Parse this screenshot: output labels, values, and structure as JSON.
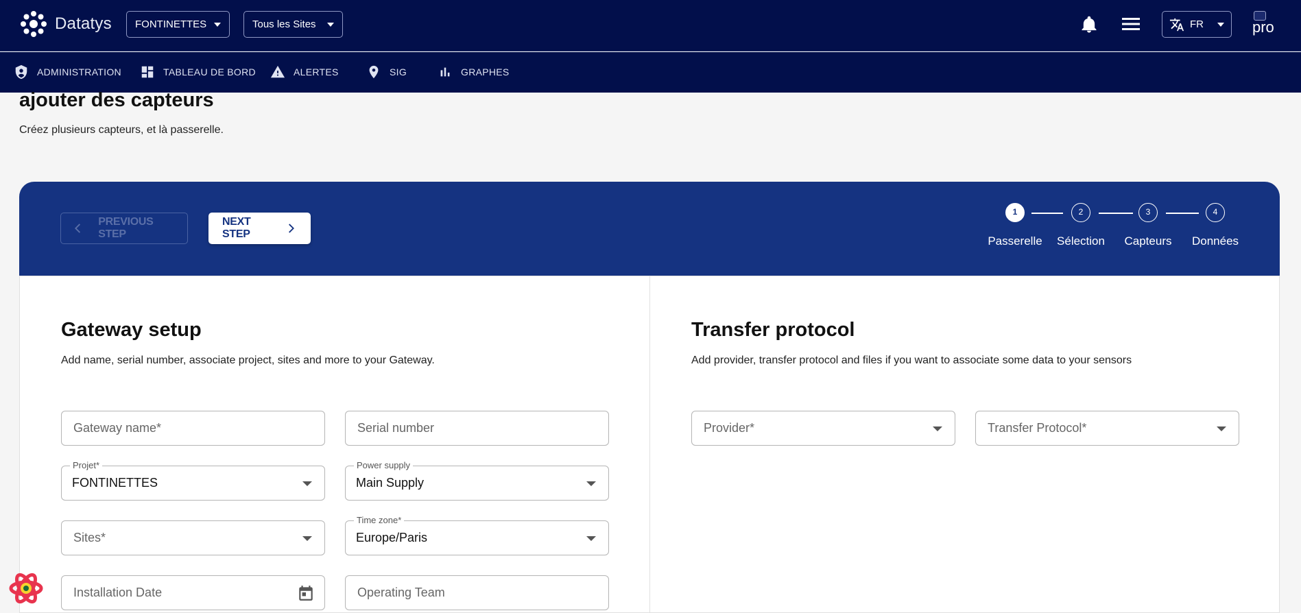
{
  "header": {
    "app_name": "Datatys",
    "project_select": "FONTINETTES",
    "sites_select": "Tous les Sites",
    "lang": "FR",
    "avatar_alt": "pro"
  },
  "nav": {
    "items": [
      {
        "label": "ADMINISTRATION",
        "icon": "shield-icon"
      },
      {
        "label": "TABLEAU DE BORD",
        "icon": "dashboard-icon"
      },
      {
        "label": "ALERTES",
        "icon": "warning-icon"
      },
      {
        "label": "SIG",
        "icon": "map-pin-icon"
      },
      {
        "label": "GRAPHES",
        "icon": "bar-chart-icon"
      }
    ]
  },
  "page": {
    "title": "ajouter des capteurs",
    "subtitle": "Créez plusieurs capteurs, et là passerelle."
  },
  "stepper": {
    "prev_label": "PREVIOUS STEP",
    "next_label": "NEXT STEP",
    "steps": [
      {
        "num": "1",
        "label": "Passerelle"
      },
      {
        "num": "2",
        "label": "Sélection"
      },
      {
        "num": "3",
        "label": "Capteurs"
      },
      {
        "num": "4",
        "label": "Données"
      }
    ],
    "active_step": 1
  },
  "gateway": {
    "title": "Gateway setup",
    "desc": "Add name, serial number, associate project, sites and more to your Gateway.",
    "name_ph": "Gateway name*",
    "serial_ph": "Serial number",
    "project_label": "Projet*",
    "project_value": "FONTINETTES",
    "power_label": "Power supply",
    "power_value": "Main Supply",
    "sites_ph": "Sites*",
    "tz_label": "Time zone*",
    "tz_value": "Europe/Paris",
    "install_ph": "Installation Date",
    "team_ph": "Operating Team"
  },
  "transfer": {
    "title": "Transfer protocol",
    "desc": "Add provider, transfer protocol and files if you want to associate some data to your sensors",
    "provider_ph": "Provider*",
    "protocol_ph": "Transfer Protocol*"
  },
  "colors": {
    "topbar": "#020f4b",
    "stepper": "#153381",
    "page_bg": "#f5f5f5"
  }
}
